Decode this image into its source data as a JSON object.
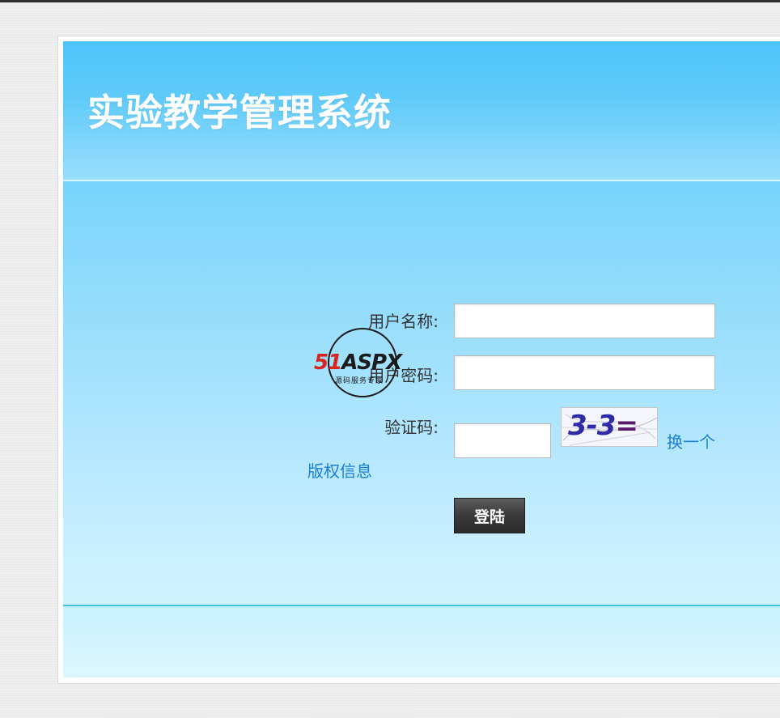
{
  "app": {
    "title": "实验教学管理系统"
  },
  "login_form": {
    "username_label": "用户名称:",
    "password_label": "用户密码:",
    "captcha_label": "验证码:",
    "username_value": "",
    "password_value": "",
    "captcha_value": "",
    "captcha_image_text": "3-3",
    "captcha_image_suffix": "=",
    "refresh_captcha_label": "换一个",
    "copyright_link_label": "版权信息",
    "login_button_label": "登陆"
  },
  "watermark": {
    "brand_number": "51",
    "brand_name": "ASPX",
    "tagline": "源码服务专家"
  },
  "colors": {
    "panel_top": "#4ec4f9",
    "panel_bottom": "#dbf6ff",
    "link": "#1a7fd4",
    "footer_line": "#3fc6dc",
    "button_bg": "#3a3a3a"
  }
}
